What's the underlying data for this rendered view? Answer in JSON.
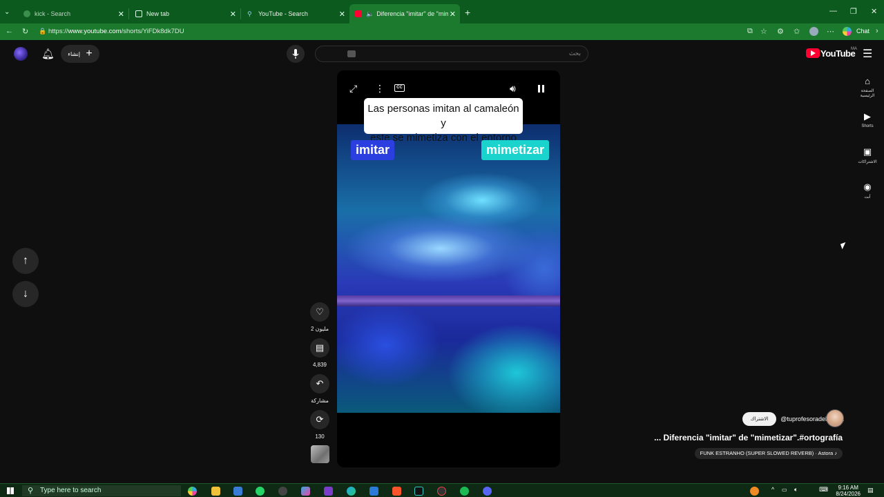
{
  "browser": {
    "tabs": [
      {
        "label": "kick - Search",
        "active": false
      },
      {
        "label": "New tab",
        "active": false
      },
      {
        "label": "YouTube - Search",
        "active": false
      },
      {
        "label": "Diferencia \"imitar\" de \"mimet...",
        "active": true
      }
    ],
    "new_tab": "+",
    "url_prefix": "https://",
    "url_host": "www.youtube.com",
    "url_path": "/shorts/YiFDk8dk7DU",
    "chat_label": "Chat"
  },
  "youtube": {
    "create_label": "إنشاء",
    "search_placeholder": "بحث",
    "logo_text": "YouTube",
    "logo_country": "MA",
    "nav": [
      {
        "label": "الصفحة الرئيسية",
        "icon": "home-icon"
      },
      {
        "label": "Shorts",
        "icon": "shorts-icon"
      },
      {
        "label": "الاشتراكات",
        "icon": "subscriptions-icon"
      },
      {
        "label": "أنت",
        "icon": "you-icon"
      }
    ]
  },
  "video": {
    "subtitle_line1": "Las personas imitan al camaleón y",
    "subtitle_line2": "este se mimetiza con el entorno",
    "tag_left": "imitar",
    "tag_right": "mimetizar"
  },
  "actions": {
    "likes": "2 مليون",
    "comments": "4,839",
    "share": "مشاركة",
    "remix": "130"
  },
  "short_info": {
    "subscribe_label": "الاشتراك",
    "channel_handle": "@tuprofesoradelengua",
    "title": "... Diferencia \"imitar\" de \"mimetizar\".#ortografía",
    "music": "FUNK ESTRANHO (SUPER SLOWED REVERB) · Astora ♪"
  },
  "taskbar": {
    "search_placeholder": "Type here to search",
    "time": "9:16 AM",
    "date": "8/24/2026"
  }
}
